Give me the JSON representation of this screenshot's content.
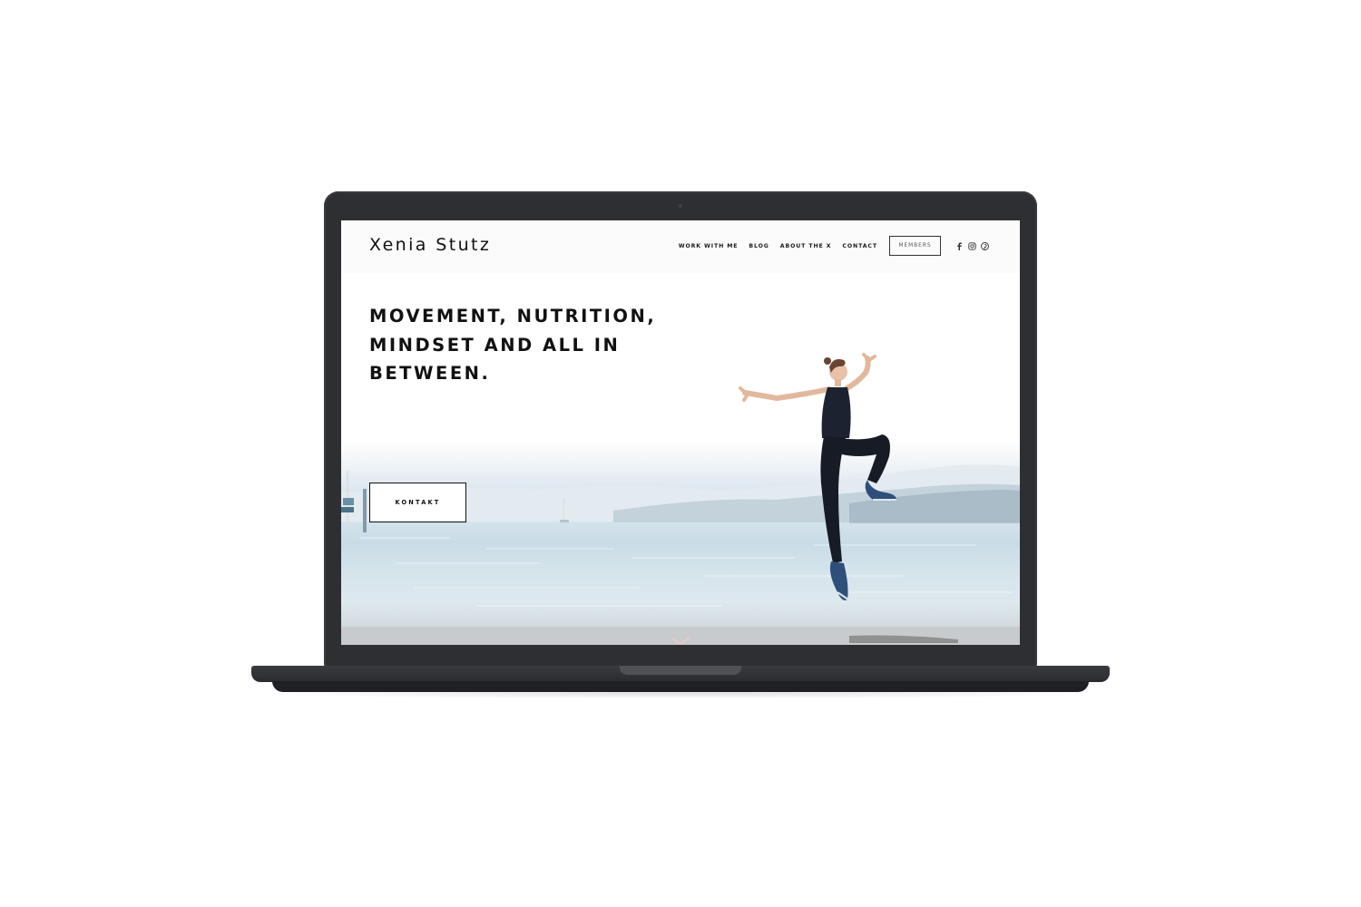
{
  "site": {
    "logo": "Xenia Stutz",
    "nav": {
      "items": [
        {
          "label": "WORK WITH ME"
        },
        {
          "label": "BLOG"
        },
        {
          "label": "ABOUT THE X"
        },
        {
          "label": "CONTACT"
        }
      ],
      "members_label": "MEMBERS",
      "social_icons": [
        "facebook-icon",
        "instagram-icon",
        "pinterest-icon"
      ]
    },
    "hero": {
      "headline": "MOVEMENT, NUTRITION, MINDSET AND ALL IN BETWEEN.",
      "cta_label": "KONTAKT"
    }
  },
  "colors": {
    "laptop_body": "#2e2f33",
    "text": "#111111",
    "header_bg": "#fbfbfb",
    "water": "#cfdee8"
  }
}
